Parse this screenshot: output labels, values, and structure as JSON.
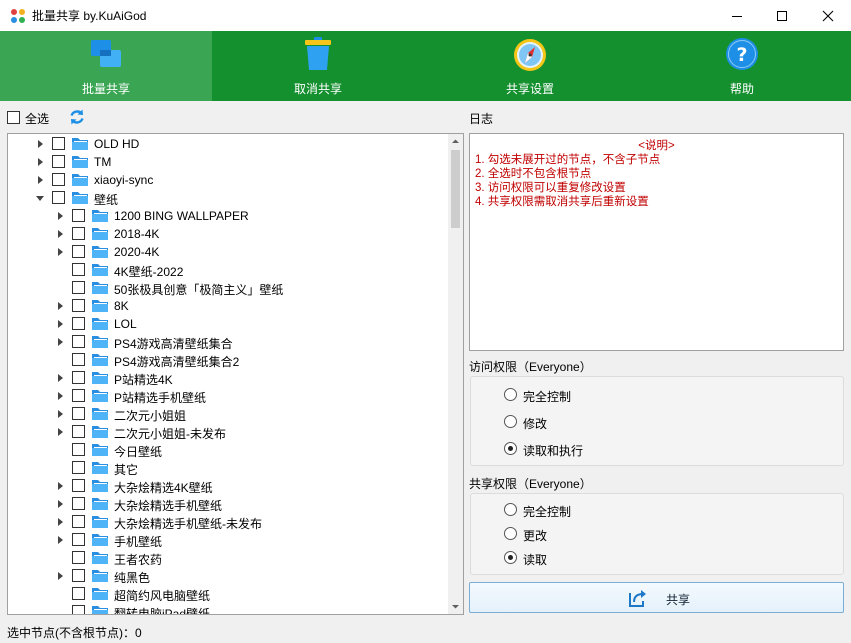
{
  "window": {
    "title": "批量共享 by.KuAiGod"
  },
  "toolbar": {
    "buttons": [
      {
        "label": "批量共享",
        "icon": "windows-share-icon",
        "active": true
      },
      {
        "label": "取消共享",
        "icon": "trash-bin-icon",
        "active": false
      },
      {
        "label": "共享设置",
        "icon": "compass-icon",
        "active": false
      },
      {
        "label": "帮助",
        "icon": "help-question-icon",
        "active": false
      }
    ]
  },
  "tree_panel": {
    "select_all_label": "全选",
    "items": [
      {
        "name": "OLD HD",
        "level": 0,
        "expander": "collapsed"
      },
      {
        "name": "TM",
        "level": 0,
        "expander": "collapsed"
      },
      {
        "name": "xiaoyi-sync",
        "level": 0,
        "expander": "collapsed"
      },
      {
        "name": "壁纸",
        "level": 0,
        "expander": "expanded"
      },
      {
        "name": "1200 BING WALLPAPER",
        "level": 1,
        "expander": "collapsed"
      },
      {
        "name": "2018-4K",
        "level": 1,
        "expander": "collapsed"
      },
      {
        "name": "2020-4K",
        "level": 1,
        "expander": "collapsed"
      },
      {
        "name": "4K壁纸-2022",
        "level": 1,
        "expander": "none"
      },
      {
        "name": "50张极具创意「极简主义」壁纸",
        "level": 1,
        "expander": "none"
      },
      {
        "name": "8K",
        "level": 1,
        "expander": "collapsed"
      },
      {
        "name": "LOL",
        "level": 1,
        "expander": "collapsed"
      },
      {
        "name": "PS4游戏高清壁纸集合",
        "level": 1,
        "expander": "collapsed"
      },
      {
        "name": "PS4游戏高清壁纸集合2",
        "level": 1,
        "expander": "none"
      },
      {
        "name": "P站精选4K",
        "level": 1,
        "expander": "collapsed"
      },
      {
        "name": "P站精选手机壁纸",
        "level": 1,
        "expander": "collapsed"
      },
      {
        "name": "二次元小姐姐",
        "level": 1,
        "expander": "collapsed"
      },
      {
        "name": "二次元小姐姐-未发布",
        "level": 1,
        "expander": "collapsed"
      },
      {
        "name": "今日壁纸",
        "level": 1,
        "expander": "none"
      },
      {
        "name": "其它",
        "level": 1,
        "expander": "none"
      },
      {
        "name": "大杂烩精选4K壁纸",
        "level": 1,
        "expander": "collapsed"
      },
      {
        "name": "大杂烩精选手机壁纸",
        "level": 1,
        "expander": "collapsed"
      },
      {
        "name": "大杂烩精选手机壁纸-未发布",
        "level": 1,
        "expander": "collapsed"
      },
      {
        "name": "手机壁纸",
        "level": 1,
        "expander": "collapsed"
      },
      {
        "name": "王者农药",
        "level": 1,
        "expander": "none"
      },
      {
        "name": "纯黑色",
        "level": 1,
        "expander": "collapsed"
      },
      {
        "name": "超简约风电脑壁纸",
        "level": 1,
        "expander": "none"
      },
      {
        "name": "翻转电脑iPad壁纸",
        "level": 1,
        "expander": "none"
      }
    ]
  },
  "log_panel": {
    "title": "日志",
    "header": "<说明>",
    "lines": [
      "1. 勾选未展开过的节点，不含子节点",
      "2. 全选时不包含根节点",
      "3. 访问权限可以重复修改设置",
      "4. 共享权限需取消共享后重新设置"
    ]
  },
  "access_permission": {
    "title": "访问权限（Everyone）",
    "options": [
      "完全控制",
      "修改",
      "读取和执行"
    ],
    "selected_index": 2
  },
  "share_permission": {
    "title": "共享权限（Everyone）",
    "options": [
      "完全控制",
      "更改",
      "读取"
    ],
    "selected_index": 2
  },
  "share_button": {
    "label": "共享"
  },
  "status": {
    "text": "选中节点(不含根节点)：0"
  },
  "colors": {
    "toolbar_bg": "#14902f",
    "toolbar_active": "#3aa553",
    "log_text": "#c00000",
    "folder": "#2a8fe0"
  }
}
